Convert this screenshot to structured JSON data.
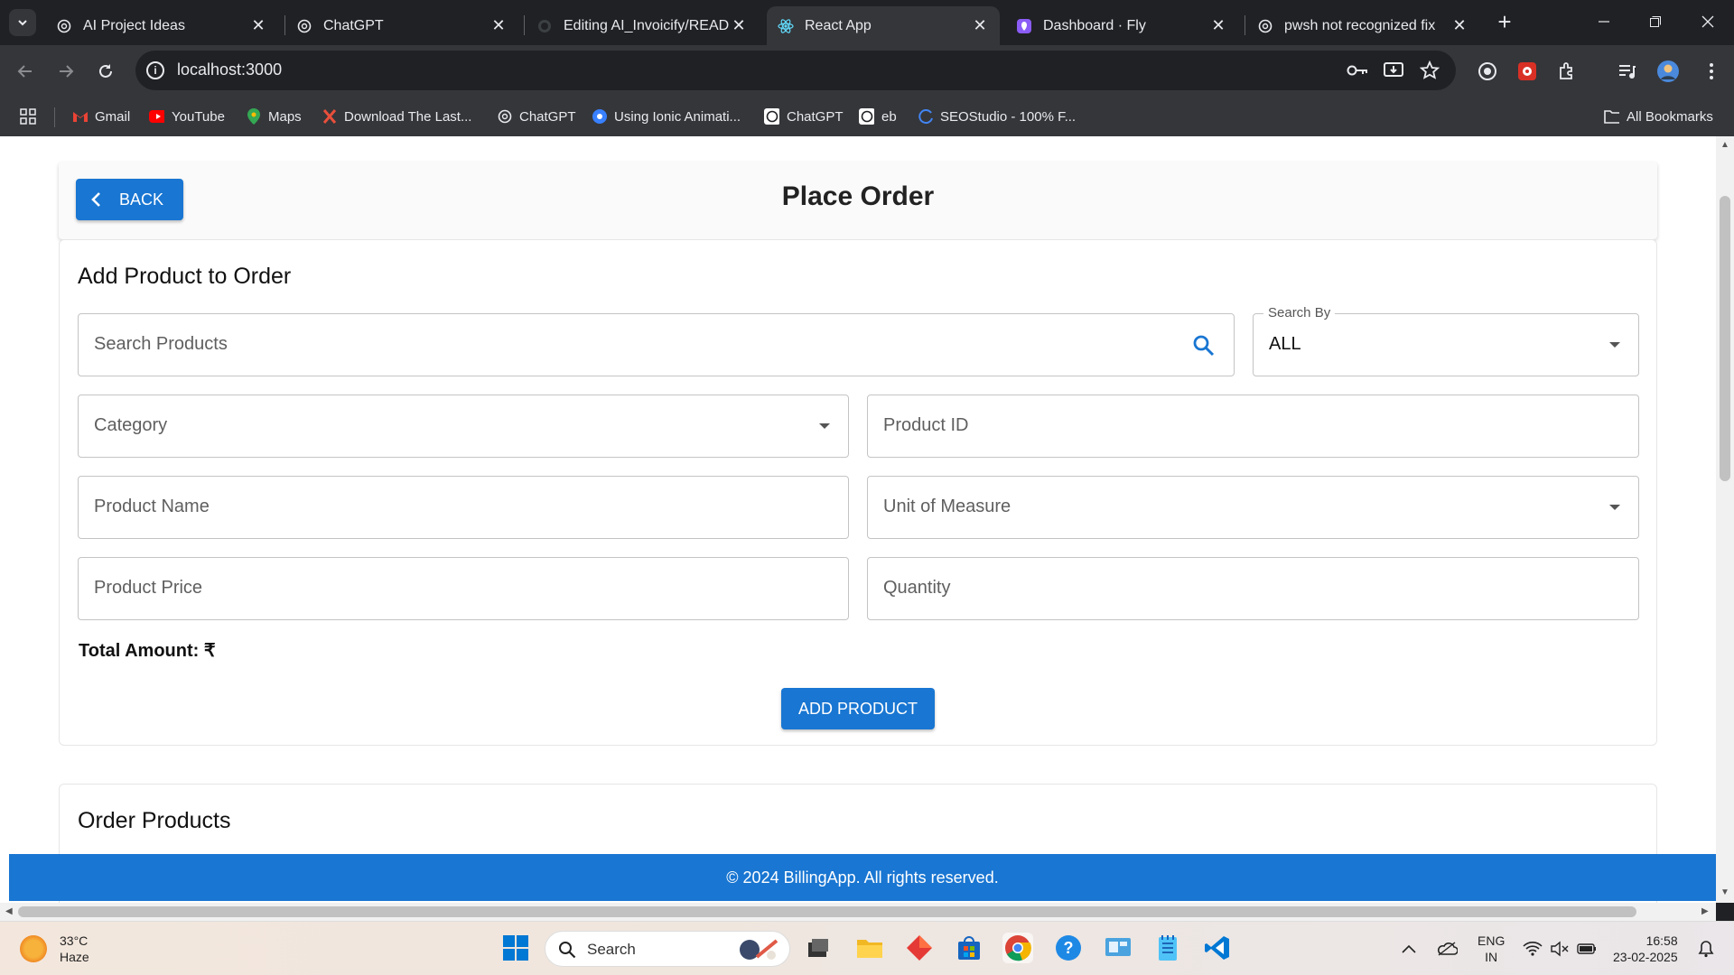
{
  "browser": {
    "tabs": [
      {
        "title": "AI Project Ideas",
        "icon": "openai-icon"
      },
      {
        "title": "ChatGPT",
        "icon": "openai-icon"
      },
      {
        "title": "Editing AI_Invoicify/README",
        "icon": "github-icon"
      },
      {
        "title": "React App",
        "icon": "react-icon",
        "active": true
      },
      {
        "title": "Dashboard · Fly",
        "icon": "fly-icon"
      },
      {
        "title": "pwsh not recognized fix",
        "icon": "openai-icon"
      }
    ],
    "url": "localhost:3000",
    "bookmarks": [
      {
        "label": "Gmail"
      },
      {
        "label": "YouTube"
      },
      {
        "label": "Maps"
      },
      {
        "label": "Download The Last..."
      },
      {
        "label": "ChatGPT"
      },
      {
        "label": "Using Ionic Animati..."
      },
      {
        "label": "ChatGPT"
      },
      {
        "label": "eb"
      },
      {
        "label": "SEOStudio - 100% F..."
      }
    ],
    "all_bookmarks": "All Bookmarks"
  },
  "page": {
    "back_label": "BACK",
    "title": "Place Order",
    "add_section_title": "Add Product to Order",
    "search": {
      "placeholder": "Search Products"
    },
    "search_by": {
      "label": "Search By",
      "value": "ALL"
    },
    "category": {
      "placeholder": "Category"
    },
    "product_id": {
      "placeholder": "Product ID"
    },
    "product_name": {
      "placeholder": "Product Name"
    },
    "unit": {
      "placeholder": "Unit of Measure"
    },
    "price": {
      "placeholder": "Product Price"
    },
    "quantity": {
      "placeholder": "Quantity"
    },
    "total_label": "Total Amount: ₹",
    "add_button": "ADD PRODUCT",
    "order_section_title": "Order Products",
    "footer": "© 2024 BillingApp. All rights reserved."
  },
  "taskbar": {
    "weather": {
      "temp": "33°C",
      "condition": "Haze"
    },
    "search_label": "Search",
    "lang": {
      "line1": "ENG",
      "line2": "IN"
    },
    "clock": {
      "time": "16:58",
      "date": "23-02-2025"
    }
  },
  "colors": {
    "primary": "#1976d2",
    "browser_dark": "#202124",
    "browser_toolbar": "#35363a"
  }
}
